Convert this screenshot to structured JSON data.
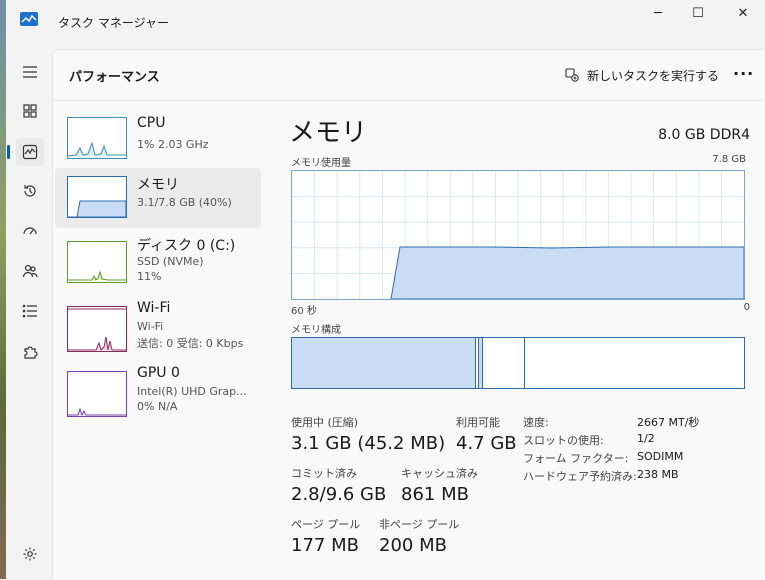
{
  "window": {
    "title": "タスク マネージャー"
  },
  "window_controls": {
    "minimize": "─",
    "maximize": "☐",
    "close": "✕"
  },
  "header": {
    "title": "パフォーマンス",
    "run_new_task": "新しいタスクを実行する",
    "more": "···"
  },
  "nav": [
    {
      "name": "processes",
      "icon": "grid-icon"
    },
    {
      "name": "performance",
      "icon": "performance-icon",
      "selected": true
    },
    {
      "name": "app-history",
      "icon": "history-icon"
    },
    {
      "name": "startup-apps",
      "icon": "speedometer-icon"
    },
    {
      "name": "users",
      "icon": "users-icon"
    },
    {
      "name": "details",
      "icon": "list-icon"
    },
    {
      "name": "services",
      "icon": "puzzle-icon"
    },
    {
      "name": "settings",
      "icon": "gear-icon"
    }
  ],
  "resources": [
    {
      "name": "CPU",
      "line1": "1%  2.03 GHz",
      "line2": "",
      "line3": ""
    },
    {
      "name": "メモリ",
      "line1": "3.1/7.8 GB (40%)",
      "line2": "",
      "line3": ""
    },
    {
      "name": "ディスク 0 (C:)",
      "line1": "SSD (NVMe)",
      "line2": "11%",
      "line3": ""
    },
    {
      "name": "Wi-Fi",
      "line1": "Wi-Fi",
      "line2": "送信: 0 受信: 0 Kbps",
      "line3": ""
    },
    {
      "name": "GPU 0",
      "line1": "Intel(R) UHD Grap...",
      "line2": "0%  N/A",
      "line3": ""
    }
  ],
  "detail": {
    "title": "メモリ",
    "spec": "8.0 GB DDR4",
    "usage_label": "メモリ使用量",
    "usage_max": "7.8 GB",
    "time_left": "60 秒",
    "time_right": "0",
    "composition_label": "メモリ構成",
    "in_use_label": "使用中 (圧縮)",
    "in_use_value": "3.1 GB (45.2 MB)",
    "available_label": "利用可能",
    "available_value": "4.7 GB",
    "committed_label": "コミット済み",
    "committed_value": "2.8/9.6 GB",
    "cached_label": "キャッシュ済み",
    "cached_value": "861 MB",
    "paged_label": "ページ プール",
    "paged_value": "177 MB",
    "nonpaged_label": "非ページ プール",
    "nonpaged_value": "200 MB",
    "specs": [
      {
        "label": "速度:",
        "value": "2667 MT/秒"
      },
      {
        "label": "スロットの使用:",
        "value": "1/2"
      },
      {
        "label": "フォーム ファクター:",
        "value": "SODIMM"
      },
      {
        "label": "ハードウェア予約済み:",
        "value": "238 MB"
      }
    ]
  },
  "colors": {
    "accent": "#005fb8",
    "memory_line": "#2b6cb0",
    "memory_fill": "#c9dcf5"
  }
}
